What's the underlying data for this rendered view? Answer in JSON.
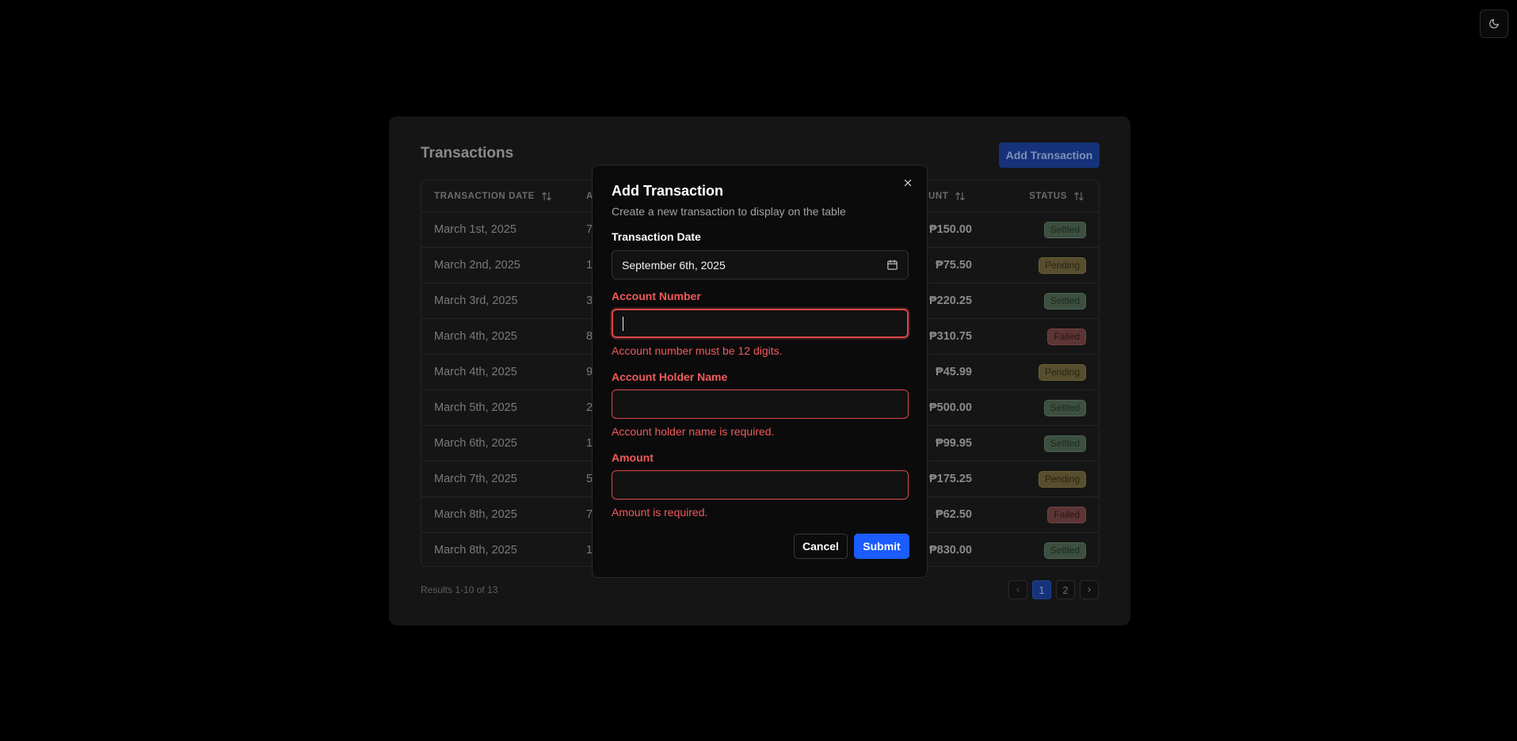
{
  "table_card": {
    "title": "Transactions",
    "add_button": "Add Transaction",
    "columns": {
      "date": "TRANSACTION DATE",
      "account": "A",
      "amount": "UNT",
      "status": "STATUS"
    },
    "rows": [
      {
        "date": "March 1st, 2025",
        "account": "7",
        "amount": "₱150.00",
        "status": "Settled"
      },
      {
        "date": "March 2nd, 2025",
        "account": "1",
        "amount": "₱75.50",
        "status": "Pending"
      },
      {
        "date": "March 3rd, 2025",
        "account": "3",
        "amount": "₱220.25",
        "status": "Settled"
      },
      {
        "date": "March 4th, 2025",
        "account": "8",
        "amount": "₱310.75",
        "status": "Failed"
      },
      {
        "date": "March 4th, 2025",
        "account": "9",
        "amount": "₱45.99",
        "status": "Pending"
      },
      {
        "date": "March 5th, 2025",
        "account": "2",
        "amount": "₱500.00",
        "status": "Settled"
      },
      {
        "date": "March 6th, 2025",
        "account": "1",
        "amount": "₱99.95",
        "status": "Settled"
      },
      {
        "date": "March 7th, 2025",
        "account": "5",
        "amount": "₱175.25",
        "status": "Pending"
      },
      {
        "date": "March 8th, 2025",
        "account": "7",
        "amount": "₱62.50",
        "status": "Failed"
      },
      {
        "date": "March 8th, 2025",
        "account": "1",
        "amount": "₱830.00",
        "status": "Settled"
      }
    ],
    "results_text": "Results 1-10 of 13",
    "pagination": {
      "prev_icon": "chevron-left-icon",
      "pages": [
        "1",
        "2"
      ],
      "current": "1",
      "next_icon": "chevron-right-icon"
    }
  },
  "theme_toggle": {
    "icon": "moon-icon"
  },
  "modal": {
    "title": "Add Transaction",
    "description": "Create a new transaction to display on the table",
    "close_icon": "close-icon",
    "fields": {
      "date": {
        "label": "Transaction Date",
        "value": "September 6th, 2025",
        "icon": "calendar-icon"
      },
      "account_number": {
        "label": "Account Number",
        "value": "",
        "error": "Account number must be 12 digits."
      },
      "account_holder": {
        "label": "Account Holder Name",
        "value": "",
        "error": "Account holder name is required."
      },
      "amount": {
        "label": "Amount",
        "value": "",
        "error": "Amount is required."
      }
    },
    "cancel_label": "Cancel",
    "submit_label": "Submit"
  },
  "colors": {
    "accent": "#1b5cff",
    "error": "#f05a5a",
    "settled": "#3c4f40",
    "pending": "#574e2f",
    "failed": "#5c3535"
  }
}
